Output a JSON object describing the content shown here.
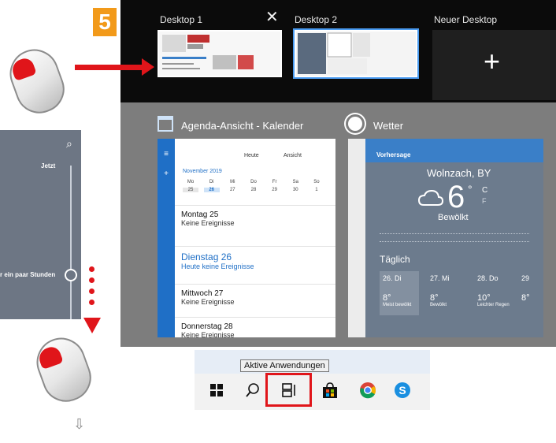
{
  "step_badge": "5",
  "task_view": {
    "desktops": [
      {
        "label": "Desktop 1"
      },
      {
        "label": "Desktop 2"
      },
      {
        "label": "Neuer Desktop"
      }
    ],
    "close_glyph": "✕",
    "plus_glyph": "+"
  },
  "windows": {
    "calendar": {
      "title": "Agenda-Ansicht - Kalender",
      "toolbar_today": "Heute",
      "toolbar_view": "Ansicht",
      "month": "November 2019",
      "weekdays": [
        "Mo",
        "Di",
        "Mi",
        "Do",
        "Fr",
        "Sa",
        "So"
      ],
      "dates": [
        "25",
        "26",
        "27",
        "28",
        "29",
        "30",
        "1"
      ],
      "days": [
        {
          "heading": "Montag 25",
          "sub": "Keine Ereignisse"
        },
        {
          "heading": "Dienstag 26",
          "sub": "Heute keine Ereignisse"
        },
        {
          "heading": "Mittwoch 27",
          "sub": "Keine Ereignisse"
        },
        {
          "heading": "Donnerstag 28",
          "sub": "Keine Ereignisse"
        }
      ]
    },
    "weather": {
      "title": "Wetter",
      "header": "Vorhersage",
      "location": "Wolnzach, BY",
      "temp": "6",
      "unit_c": "C",
      "unit_f": "F",
      "condition": "Bewölkt",
      "section": "Täglich",
      "forecast": [
        {
          "day": "26. Di",
          "temp": "8°",
          "desc": "Meist bewölkt"
        },
        {
          "day": "27. Mi",
          "temp": "8°",
          "desc": "Bewölkt"
        },
        {
          "day": "28. Do",
          "temp": "10°",
          "desc": "Leichter Regen"
        },
        {
          "day": "29",
          "temp": "8°",
          "desc": ""
        }
      ]
    }
  },
  "timeline": {
    "label_now": "Jetzt",
    "label_hours": "r ein paar Stunden"
  },
  "taskbar": {
    "tooltip": "Aktive Anwendungen"
  },
  "colors": {
    "accent_red": "#e0151a",
    "badge_orange": "#f29a1a",
    "calendar_blue": "#1f6fc6"
  }
}
